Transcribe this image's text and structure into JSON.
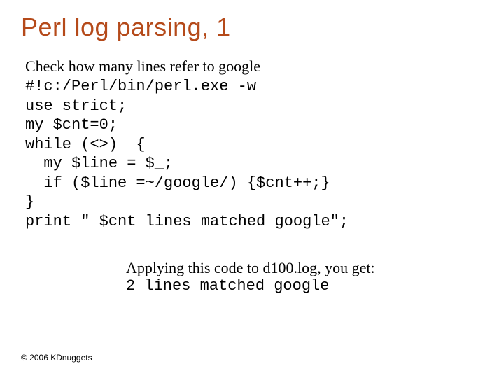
{
  "title": "Perl log parsing, 1",
  "intro": "Check how many lines refer to google",
  "code": "#!c:/Perl/bin/perl.exe -w\nuse strict;\nmy $cnt=0;\nwhile (<>)  {\n  my $line = $_;\n  if ($line =~/google/) {$cnt++;}\n}\nprint \" $cnt lines matched google\";",
  "result": {
    "intro": "Applying this code to d100.log, you get:",
    "output": "2 lines matched google"
  },
  "footer": "© 2006 KDnuggets"
}
